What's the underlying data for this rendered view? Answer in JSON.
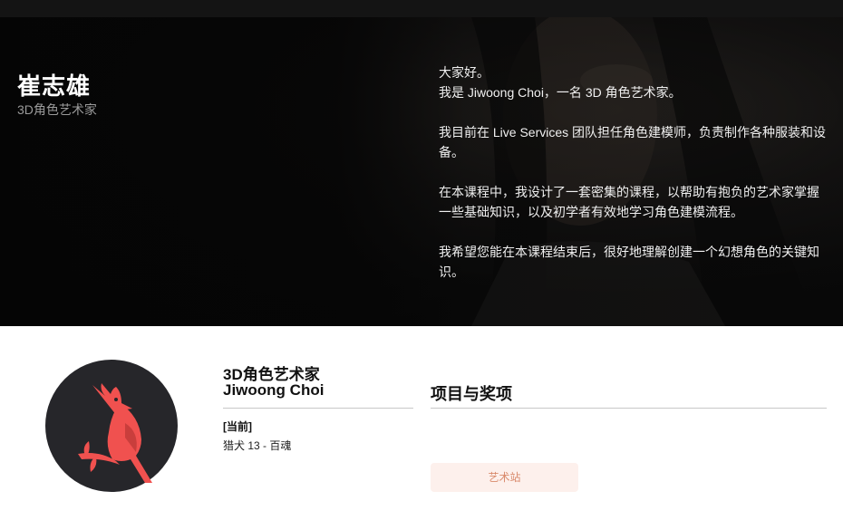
{
  "hero": {
    "name": "崔志雄",
    "role": "3D角色艺术家",
    "intro": [
      "大家好。",
      "我是 Jiwoong Choi，一名 3D 角色艺术家。",
      "我目前在 Live Services 团队担任角色建模师，负责制作各种服装和设备。",
      "在本课程中，我设计了一套密集的课程，以帮助有抱负的艺术家掌握一些基础知识，以及初学者有效地学习角色建模流程。",
      "我希望您能在本课程结束后，很好地理解创建一个幻想角色的关键知识。"
    ]
  },
  "bio": {
    "title_line1": "3D角色艺术家",
    "title_line2": "Jiwoong Choi",
    "current_label": "[当前]",
    "current_value": "猎犬 13 - 百魂"
  },
  "projects": {
    "title": "项目与奖项",
    "artstation_label": "艺术站"
  },
  "colors": {
    "accent": "#f0514f",
    "avatar_bg": "#26262a",
    "button_bg": "#fdf0ec",
    "button_text": "#d98a6c"
  },
  "icons": {
    "avatar": "cardinal-bird-icon"
  }
}
